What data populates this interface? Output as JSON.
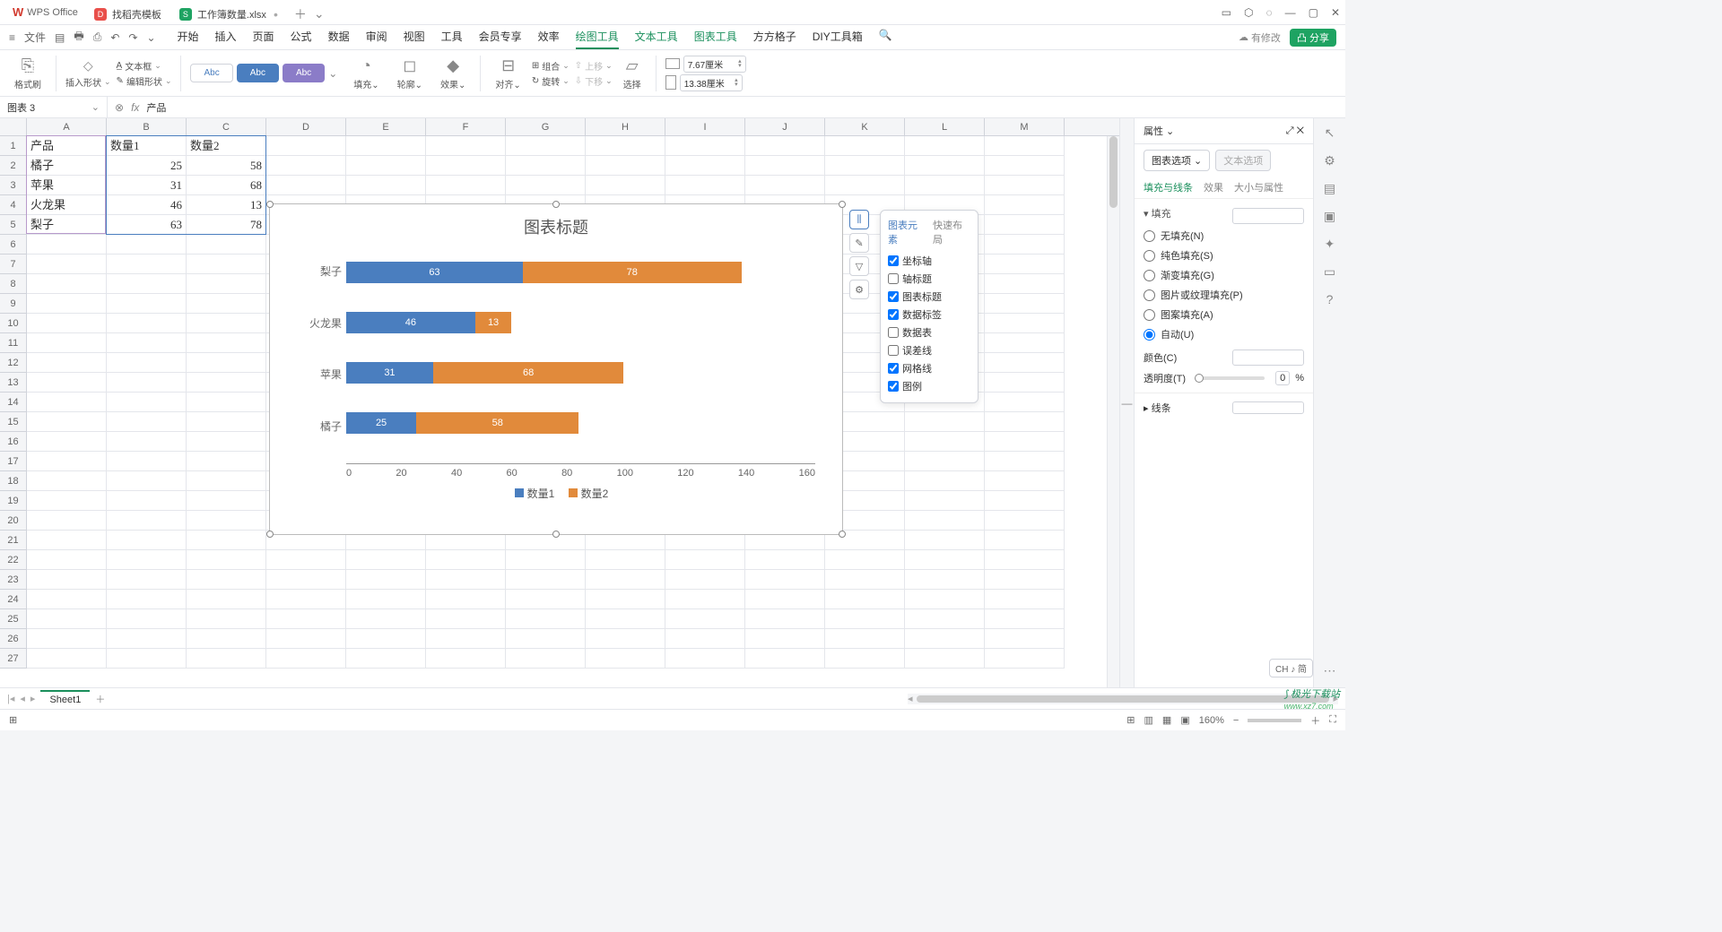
{
  "titlebar": {
    "app": "WPS Office",
    "tabs": [
      {
        "icon": "d",
        "label": "找稻壳模板"
      },
      {
        "icon": "s",
        "label": "工作簿数量.xlsx"
      }
    ]
  },
  "menubar": {
    "file": "文件",
    "items": [
      "开始",
      "插入",
      "页面",
      "公式",
      "数据",
      "审阅",
      "视图",
      "工具",
      "会员专享",
      "效率",
      "绘图工具",
      "文本工具",
      "图表工具",
      "方方格子",
      "DIY工具箱"
    ],
    "active": "绘图工具",
    "mod": "有修改",
    "share": "分享"
  },
  "ribbon": {
    "fmtbrush": "格式刷",
    "insertshape": "插入形状",
    "textbox": "文本框",
    "editshape": "编辑形状",
    "abc": "Abc",
    "fill": "填充",
    "outline": "轮廓",
    "effect": "效果",
    "align": "对齐",
    "group": "组合",
    "rotate": "旋转",
    "up": "上移",
    "down": "下移",
    "select": "选择",
    "w": "7.67厘米",
    "h": "13.38厘米"
  },
  "formula": {
    "name": "图表 3",
    "text": "产品"
  },
  "cols": [
    "A",
    "B",
    "C",
    "D",
    "E",
    "F",
    "G",
    "H",
    "I",
    "J",
    "K",
    "L",
    "M"
  ],
  "data": {
    "h": [
      "产品",
      "数量1",
      "数量2"
    ],
    "rows": [
      [
        "橘子",
        "25",
        "58"
      ],
      [
        "苹果",
        "31",
        "68"
      ],
      [
        "火龙果",
        "46",
        "13"
      ],
      [
        "梨子",
        "63",
        "78"
      ]
    ]
  },
  "chart_data": {
    "type": "bar",
    "title": "图表标题",
    "categories": [
      "梨子",
      "火龙果",
      "苹果",
      "橘子"
    ],
    "series": [
      {
        "name": "数量1",
        "values": [
          63,
          46,
          31,
          25
        ],
        "color": "#4a7ebf"
      },
      {
        "name": "数量2",
        "values": [
          78,
          13,
          68,
          58
        ],
        "color": "#e18a3b"
      }
    ],
    "xticks": [
      0,
      20,
      40,
      60,
      80,
      100,
      120,
      140,
      160
    ],
    "xlim": [
      0,
      160
    ]
  },
  "popup": {
    "tab1": "图表元素",
    "tab2": "快速布局",
    "items": [
      {
        "label": "坐标轴",
        "checked": true
      },
      {
        "label": "轴标题",
        "checked": false
      },
      {
        "label": "图表标题",
        "checked": true
      },
      {
        "label": "数据标签",
        "checked": true
      },
      {
        "label": "数据表",
        "checked": false
      },
      {
        "label": "误差线",
        "checked": false
      },
      {
        "label": "网格线",
        "checked": true
      },
      {
        "label": "图例",
        "checked": true
      }
    ]
  },
  "rightpanel": {
    "title": "属性",
    "seg1": "图表选项",
    "seg2": "文本选项",
    "tab_fill": "填充与线条",
    "tab_eff": "效果",
    "tab_size": "大小与属性",
    "fill_title": "填充",
    "fill_opts": [
      "无填充(N)",
      "纯色填充(S)",
      "渐变填充(G)",
      "图片或纹理填充(P)",
      "图案填充(A)",
      "自动(U)"
    ],
    "fill_selected": 5,
    "color": "颜色(C)",
    "transp": "透明度(T)",
    "transp_val": "0",
    "transp_unit": "%",
    "line_title": "线条"
  },
  "sheetbar": {
    "name": "Sheet1"
  },
  "statusbar": {
    "zoom": "160%"
  },
  "chbadge": "CH ♪ 简",
  "watermark": "极光下载站"
}
